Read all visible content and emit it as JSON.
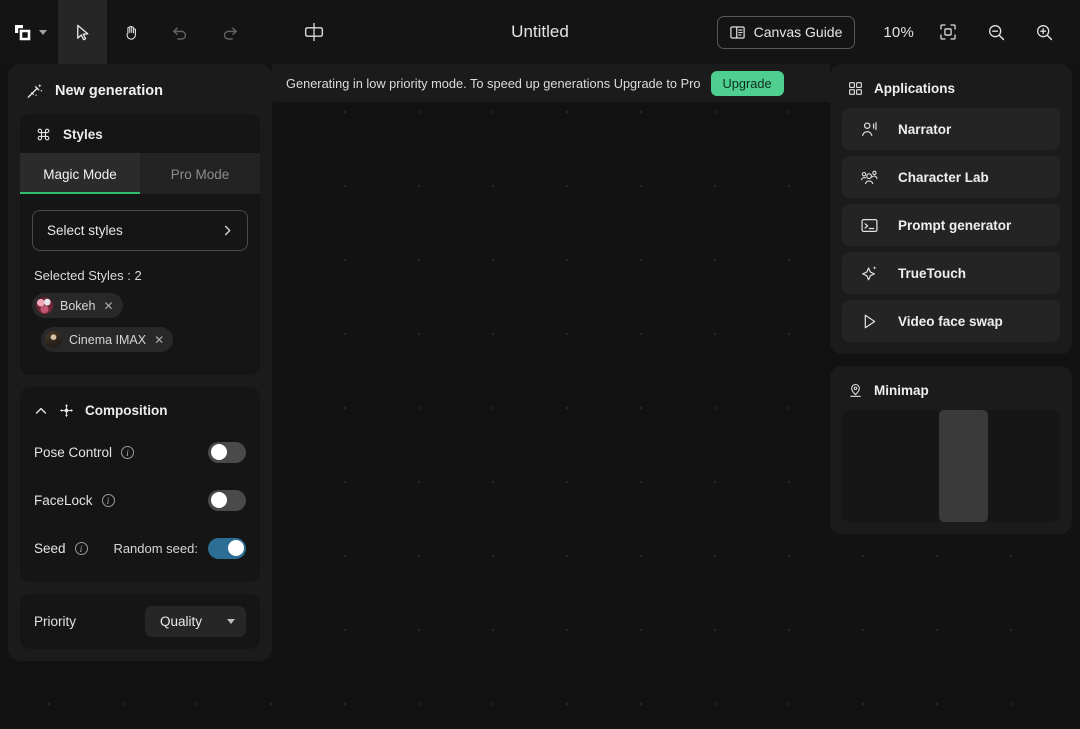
{
  "topbar": {
    "logo_icon": "overlapping-squares-logo",
    "logo_caret_icon": "chevron-down-icon",
    "tools": [
      {
        "name": "select-tool",
        "icon": "cursor-arrow-icon",
        "active": true
      },
      {
        "name": "hand-tool",
        "icon": "hand-icon",
        "active": false
      },
      {
        "name": "undo-tool",
        "icon": "undo-arrow-icon",
        "active": false
      },
      {
        "name": "redo-tool",
        "icon": "redo-arrow-icon",
        "active": false
      },
      {
        "name": "frame-tool",
        "icon": "frame-icon",
        "active": false
      }
    ],
    "title": "Untitled",
    "canvas_guide_label": "Canvas Guide",
    "canvas_guide_icon": "book-icon",
    "zoom_level": "10%",
    "fit_icon": "fit-to-screen-icon",
    "zoom_out_icon": "magnifier-minus-icon",
    "zoom_in_icon": "magnifier-plus-icon"
  },
  "banner": {
    "text": "Generating in low priority mode. To speed up generations Upgrade to Pro",
    "upgrade_label": "Upgrade",
    "upgrade_color": "#4ecf8f"
  },
  "left_panel": {
    "header": "New generation",
    "header_icon": "magic-wand-icon",
    "styles": {
      "title": "Styles",
      "icon": "command-icon",
      "modes": [
        {
          "label": "Magic Mode",
          "active": true
        },
        {
          "label": "Pro Mode",
          "active": false
        }
      ],
      "active_accent": "#2fbf6e",
      "select_styles_label": "Select styles",
      "select_styles_chevron": "chevron-right-icon",
      "selected_title": "Selected Styles : 2",
      "selected": [
        {
          "label": "Bokeh",
          "thumb": "bokeh",
          "remove_icon": "close-icon"
        },
        {
          "label": "Cinema IMAX",
          "thumb": "imax",
          "remove_icon": "close-icon"
        }
      ]
    },
    "composition": {
      "title": "Composition",
      "collapse_icon": "chevron-up-icon",
      "icon": "move-arrows-icon",
      "rows": [
        {
          "label": "Pose Control",
          "info_icon": "info-icon",
          "toggle_on": false
        },
        {
          "label": "FaceLock",
          "info_icon": "info-icon",
          "toggle_on": false
        },
        {
          "label": "Seed",
          "info_icon": "info-icon",
          "sub_label": "Random seed:",
          "toggle_on": true
        }
      ],
      "toggle_on_color": "#2d6e94"
    },
    "priority": {
      "label": "Priority",
      "value": "Quality",
      "caret_icon": "chevron-down-icon"
    }
  },
  "right_panel": {
    "applications": {
      "title": "Applications",
      "icon": "grid-squares-icon",
      "items": [
        {
          "label": "Narrator",
          "icon": "person-speaking-icon"
        },
        {
          "label": "Character Lab",
          "icon": "people-group-icon"
        },
        {
          "label": "Prompt generator",
          "icon": "terminal-icon"
        },
        {
          "label": "TrueTouch",
          "icon": "sparkle-icon"
        },
        {
          "label": "Video face swap",
          "icon": "play-triangle-icon"
        }
      ]
    },
    "minimap": {
      "title": "Minimap",
      "icon": "map-pin-icon",
      "viewport_name": "minimap-viewport"
    }
  }
}
